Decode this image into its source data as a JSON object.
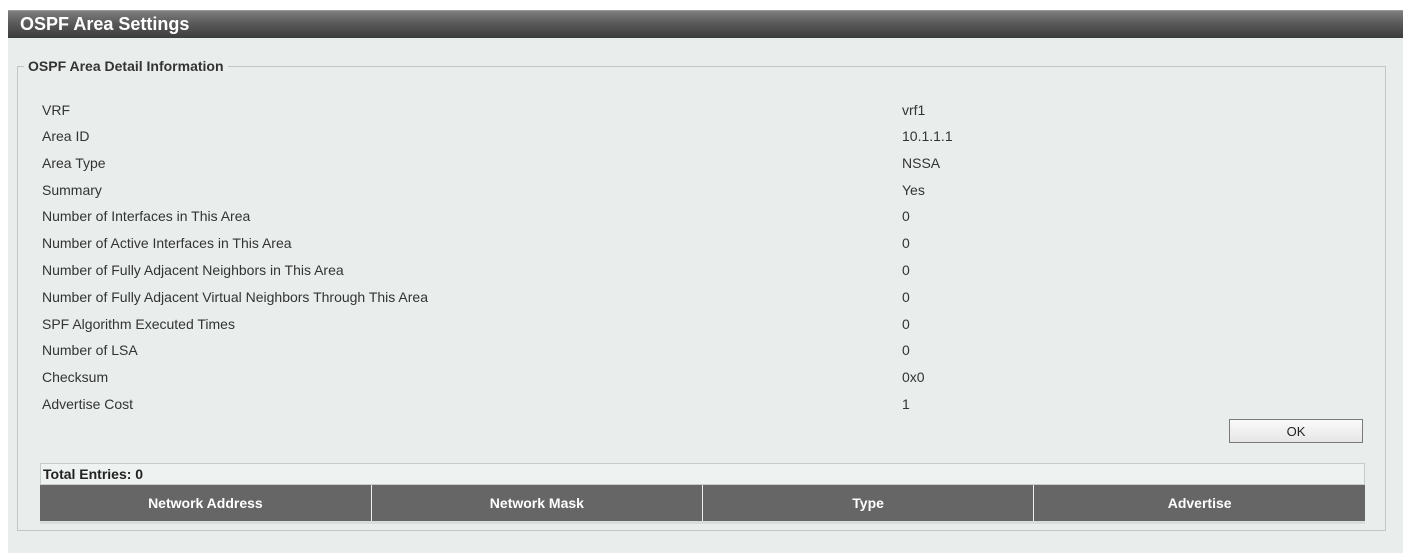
{
  "panel": {
    "title": "OSPF Area Settings"
  },
  "detail": {
    "legend": "OSPF Area Detail Information",
    "rows": [
      {
        "label": "VRF",
        "value": "vrf1"
      },
      {
        "label": "Area ID",
        "value": "10.1.1.1"
      },
      {
        "label": "Area Type",
        "value": "NSSA"
      },
      {
        "label": "Summary",
        "value": "Yes"
      },
      {
        "label": "Number of Interfaces in This Area",
        "value": "0"
      },
      {
        "label": "Number of Active Interfaces in This Area",
        "value": "0"
      },
      {
        "label": "Number of Fully Adjacent Neighbors in This Area",
        "value": "0"
      },
      {
        "label": "Number of Fully Adjacent Virtual Neighbors Through This Area",
        "value": "0"
      },
      {
        "label": "SPF Algorithm Executed Times",
        "value": "0"
      },
      {
        "label": "Number of LSA",
        "value": "0"
      },
      {
        "label": "Checksum",
        "value": "0x0"
      },
      {
        "label": "Advertise Cost",
        "value": "1"
      }
    ],
    "ok_label": "OK"
  },
  "entries": {
    "total_label": "Total Entries: 0",
    "columns": [
      "Network Address",
      "Network Mask",
      "Type",
      "Advertise"
    ]
  }
}
